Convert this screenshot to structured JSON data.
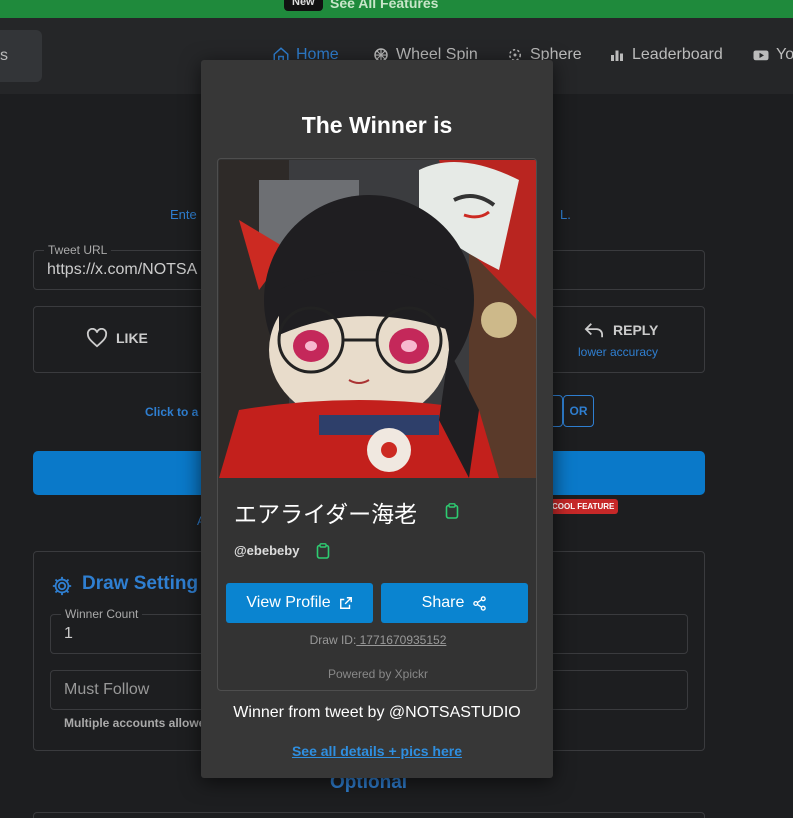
{
  "banner": {
    "new_badge": "New",
    "see_all": "See All Features"
  },
  "topnav": {
    "logo_text": "s",
    "items": [
      {
        "label": "Home",
        "icon": "home-icon",
        "active": true
      },
      {
        "label": "Wheel Spin",
        "icon": "wheel-icon"
      },
      {
        "label": "Sphere",
        "icon": "sphere-icon"
      },
      {
        "label": "Leaderboard",
        "icon": "leaderboard-icon"
      },
      {
        "label": "Yo",
        "icon": "youtube-icon"
      }
    ]
  },
  "main": {
    "instruction_left": "Ente",
    "instruction_right": "L.",
    "tweet_url": {
      "legend": "Tweet URL",
      "value": "https://x.com/NOTSA"
    },
    "like_label": "LIKE",
    "reply_label": "REPLY",
    "reply_sub": "lower accuracy",
    "click_text": "Click to a",
    "or_label": "OR",
    "bottom_link": "A",
    "cool_feature": "COOL FEATURE",
    "draw_settings_title": "Draw Setting",
    "winner_count": {
      "legend": "Winner Count",
      "value": "1"
    },
    "must_follow": "Must Follow",
    "multiple_accounts": "Multiple accounts allowe",
    "optional_title": "Optional"
  },
  "modal": {
    "title": "The Winner is",
    "winner_name": "エアライダー海老",
    "handle": "@ebebeby",
    "view_profile": "View Profile",
    "share": "Share",
    "draw_id_label": "Draw ID:",
    "draw_id_value": " 1771670935152",
    "powered_by": "Powered by Xpickr",
    "from_tweet": "Winner from tweet by @NOTSASTUDIO",
    "details_link": "See all details + pics here"
  },
  "colors": {
    "accent": "#0a84d0",
    "link": "#2f7fd1",
    "clipboard": "#2ecc71",
    "banner": "#1f8a3c"
  }
}
